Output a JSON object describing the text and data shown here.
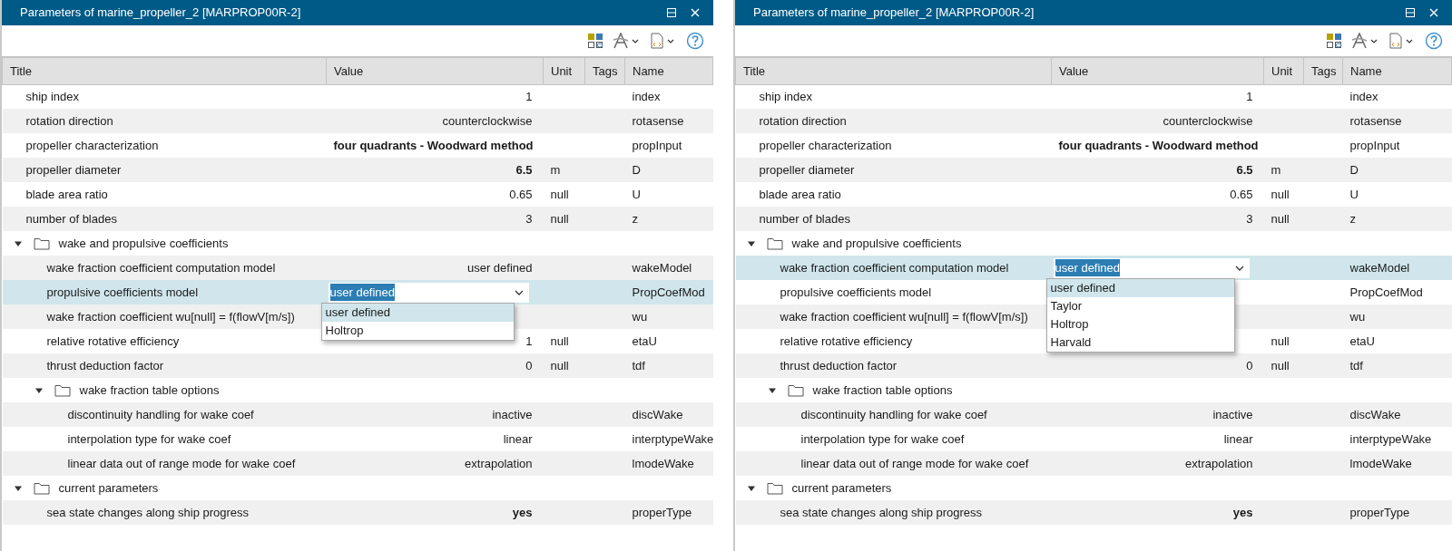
{
  "panels": [
    {
      "title": "Parameters of marine_propeller_2 [MARPROP00R-2]",
      "columns": [
        "Title",
        "Value",
        "Unit",
        "Tags",
        "Name"
      ],
      "rows": [
        {
          "kind": "param",
          "title": "ship index",
          "value": "1",
          "name": "index",
          "selected": false
        },
        {
          "kind": "param",
          "title": "rotation direction",
          "value": "counterclockwise",
          "name": "rotasense",
          "selected": false
        },
        {
          "kind": "param",
          "title": "propeller characterization",
          "value": "four quadrants - Woodward method",
          "bold": true,
          "name": "propInput",
          "selected": false
        },
        {
          "kind": "param",
          "title": "propeller diameter",
          "value": "6.5",
          "bold": true,
          "unit": "m",
          "name": "D",
          "selected": false
        },
        {
          "kind": "param",
          "title": "blade area ratio",
          "value": "0.65",
          "unit": "null",
          "name": "U",
          "selected": false
        },
        {
          "kind": "param",
          "title": "number of blades",
          "value": "3",
          "unit": "null",
          "name": "z",
          "selected": false
        },
        {
          "kind": "group",
          "title": "wake and propulsive coefficients",
          "expanded": true,
          "selected": false,
          "children": [
            {
              "kind": "param",
              "title": "wake fraction coefficient computation model",
              "value": "user defined",
              "name": "wakeModel",
              "selected": false
            },
            {
              "kind": "param",
              "title": "propulsive coefficients model",
              "name": "PropCoefMod",
              "selected": true,
              "editor": {
                "text": "user defined",
                "options": [
                  {
                    "label": "user defined",
                    "selected": true
                  },
                  {
                    "label": "Holtrop",
                    "selected": false
                  }
                ]
              }
            },
            {
              "kind": "param",
              "title": "wake fraction coefficient wu[null] = f(flowV[m/s])",
              "name": "wu",
              "selected": false
            },
            {
              "kind": "param",
              "title": "relative rotative efficiency",
              "value": "1",
              "unit": "null",
              "name": "etaU",
              "selected": false
            },
            {
              "kind": "param",
              "title": "thrust deduction factor",
              "value": "0",
              "unit": "null",
              "name": "tdf",
              "selected": false
            },
            {
              "kind": "group",
              "title": "wake fraction table options",
              "expanded": true,
              "selected": false,
              "children": [
                {
                  "kind": "param",
                  "title": "discontinuity handling for wake coef",
                  "value": "inactive",
                  "name": "discWake",
                  "selected": false
                },
                {
                  "kind": "param",
                  "title": "interpolation type for wake coef",
                  "value": "linear",
                  "name": "interptypeWake",
                  "selected": false
                },
                {
                  "kind": "param",
                  "title": "linear data out of range mode for wake coef",
                  "value": "extrapolation",
                  "name": "lmodeWake",
                  "selected": false
                }
              ]
            }
          ]
        },
        {
          "kind": "group",
          "title": "current parameters",
          "expanded": true,
          "selected": false,
          "children": [
            {
              "kind": "param",
              "title": "sea state changes along ship progress",
              "value": "yes",
              "bold": true,
              "name": "properType",
              "selected": false
            }
          ]
        }
      ]
    },
    {
      "title": "Parameters of marine_propeller_2 [MARPROP00R-2]",
      "columns": [
        "Title",
        "Value",
        "Unit",
        "Tags",
        "Name"
      ],
      "rows": [
        {
          "kind": "param",
          "title": "ship index",
          "value": "1",
          "name": "index",
          "selected": false
        },
        {
          "kind": "param",
          "title": "rotation direction",
          "value": "counterclockwise",
          "name": "rotasense",
          "selected": false
        },
        {
          "kind": "param",
          "title": "propeller characterization",
          "value": "four quadrants - Woodward method",
          "bold": true,
          "name": "propInput",
          "selected": false
        },
        {
          "kind": "param",
          "title": "propeller diameter",
          "value": "6.5",
          "bold": true,
          "unit": "m",
          "name": "D",
          "selected": false
        },
        {
          "kind": "param",
          "title": "blade area ratio",
          "value": "0.65",
          "unit": "null",
          "name": "U",
          "selected": false
        },
        {
          "kind": "param",
          "title": "number of blades",
          "value": "3",
          "unit": "null",
          "name": "z",
          "selected": false
        },
        {
          "kind": "group",
          "title": "wake and propulsive coefficients",
          "expanded": true,
          "selected": false,
          "children": [
            {
              "kind": "param",
              "title": "wake fraction coefficient computation model",
              "name": "wakeModel",
              "selected": true,
              "editor": {
                "text": "user defined",
                "options": [
                  {
                    "label": "user defined",
                    "selected": true
                  },
                  {
                    "label": "Taylor",
                    "selected": false
                  },
                  {
                    "label": "Holtrop",
                    "selected": false
                  },
                  {
                    "label": "Harvald",
                    "selected": false
                  }
                ]
              }
            },
            {
              "kind": "param",
              "title": "propulsive coefficients model",
              "name": "PropCoefMod",
              "selected": false
            },
            {
              "kind": "param",
              "title": "wake fraction coefficient wu[null] = f(flowV[m/s])",
              "name": "wu",
              "selected": false
            },
            {
              "kind": "param",
              "title": "relative rotative efficiency",
              "unit": "null",
              "name": "etaU",
              "selected": false
            },
            {
              "kind": "param",
              "title": "thrust deduction factor",
              "value": "0",
              "unit": "null",
              "name": "tdf",
              "selected": false
            },
            {
              "kind": "group",
              "title": "wake fraction table options",
              "expanded": true,
              "selected": false,
              "children": [
                {
                  "kind": "param",
                  "title": "discontinuity handling for wake coef",
                  "value": "inactive",
                  "name": "discWake",
                  "selected": false
                },
                {
                  "kind": "param",
                  "title": "interpolation type for wake coef",
                  "value": "linear",
                  "name": "interptypeWake",
                  "selected": false
                },
                {
                  "kind": "param",
                  "title": "linear data out of range mode for wake coef",
                  "value": "extrapolation",
                  "name": "lmodeWake",
                  "selected": false
                }
              ]
            }
          ]
        },
        {
          "kind": "group",
          "title": "current parameters",
          "expanded": true,
          "selected": false,
          "children": [
            {
              "kind": "param",
              "title": "sea state changes along ship progress",
              "value": "yes",
              "bold": true,
              "name": "properType",
              "selected": false
            }
          ]
        }
      ]
    }
  ]
}
